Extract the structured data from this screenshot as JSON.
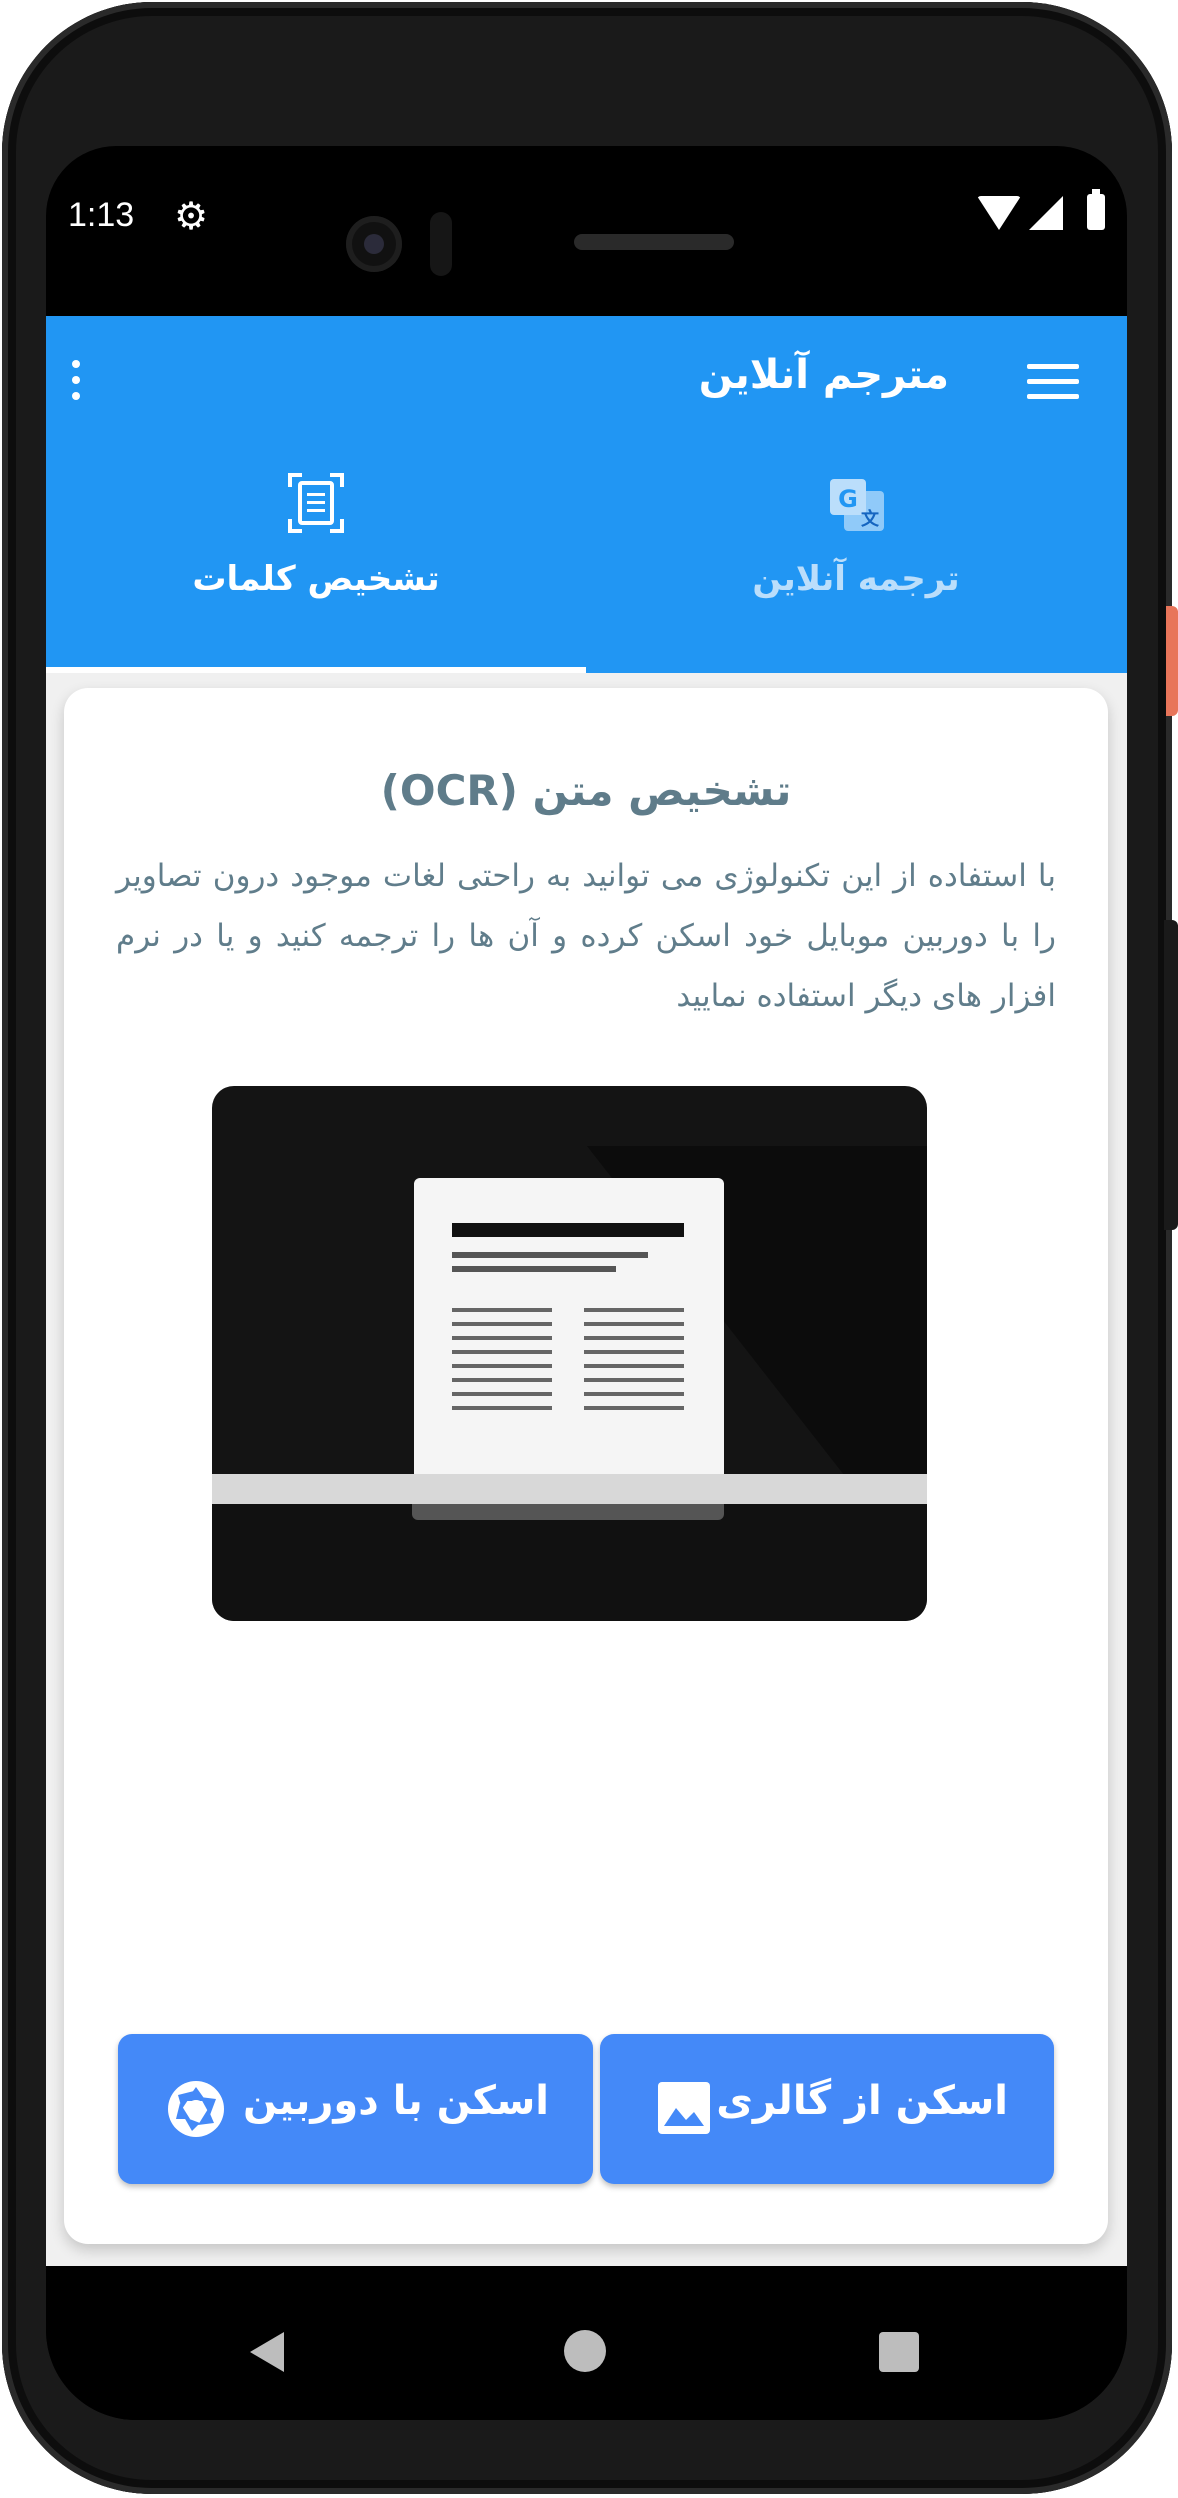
{
  "status_bar": {
    "time": "1:13",
    "icons": [
      "gear-icon",
      "wifi-icon",
      "signal-icon",
      "battery-icon"
    ]
  },
  "app_bar": {
    "title": "مترجم آنلاین",
    "menu_icon": "hamburger-menu-icon",
    "more_icon": "more-vert-icon",
    "color": "#2196F3"
  },
  "tabs": [
    {
      "label": "تشخیص کلمات",
      "icon": "document-scanner-icon",
      "selected": true
    },
    {
      "label": "ترجمه آنلاین",
      "icon": "google-translate-icon",
      "selected": false
    }
  ],
  "card": {
    "title": "تشخیص متن (OCR)",
    "description": "با استفاده از این تکنولوژی می توانید به راحتی لغات موجود درون تصاویر را با دوربین موبایل خود اسکن کرده و آن ها را ترجمه کنید و یا در نرم افزار های دیگر استفاده نمایید",
    "illustration": "document-scanner-illustration"
  },
  "buttons": {
    "camera": {
      "label": "اسکن با دوربین",
      "icon": "camera-shutter-icon"
    },
    "gallery": {
      "label": "اسکن از گالری",
      "icon": "image-icon"
    },
    "color": "#4489F8"
  },
  "nav_bar": {
    "icons": [
      "back-icon",
      "home-icon",
      "recents-icon"
    ]
  }
}
